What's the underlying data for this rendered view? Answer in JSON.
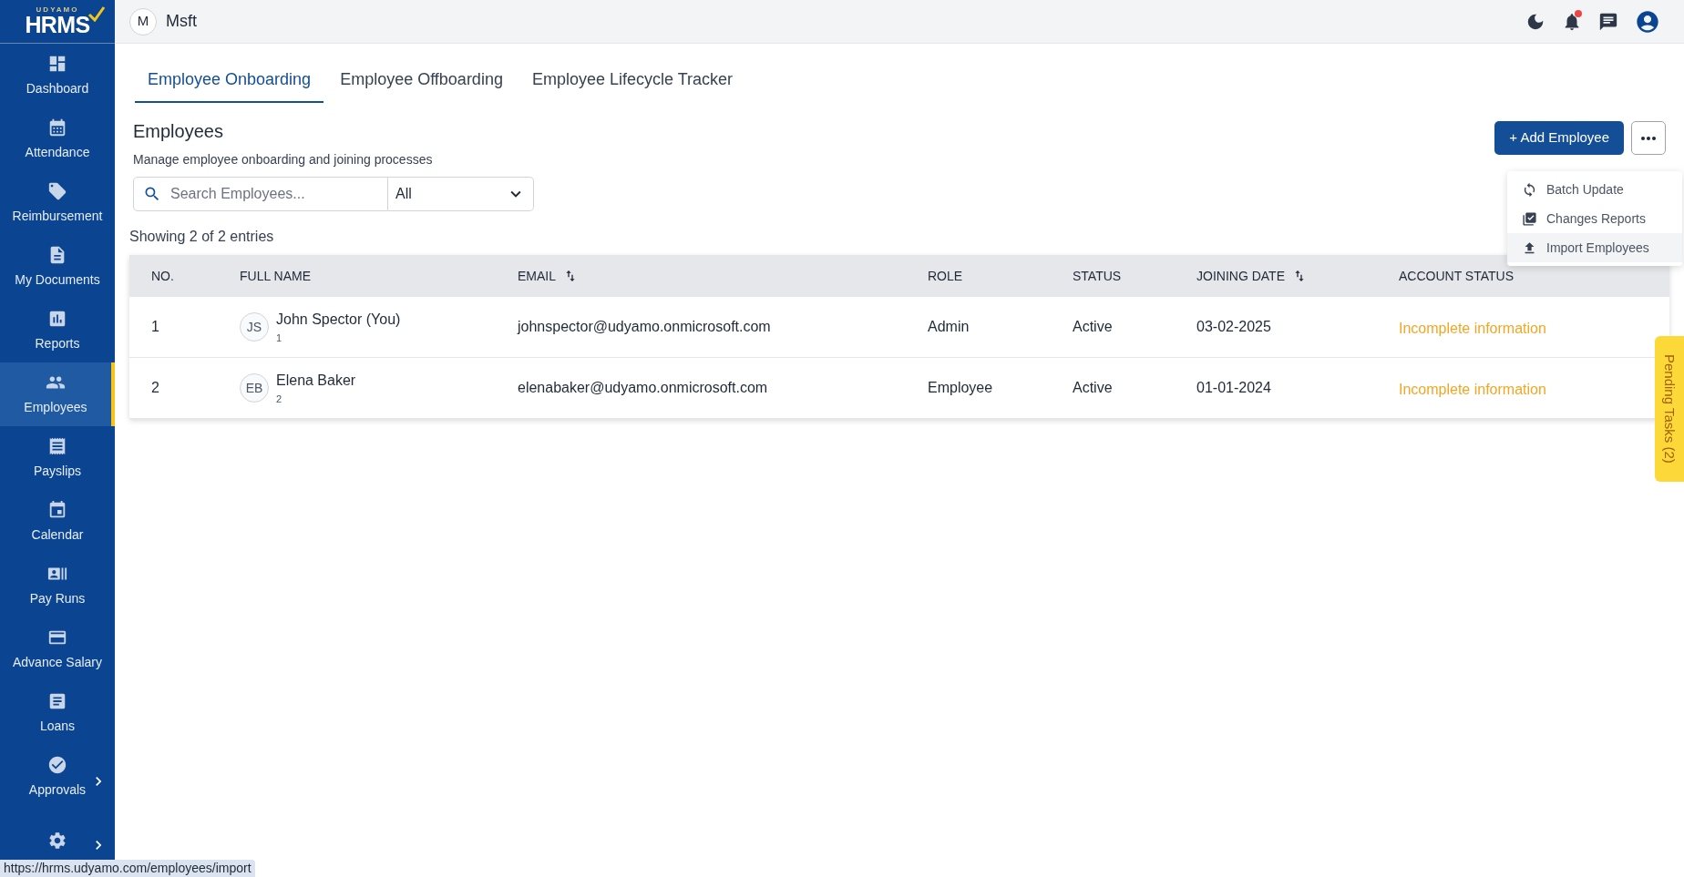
{
  "logo": {
    "small": "UDYAMO",
    "main": "HRMS"
  },
  "sidebar": {
    "items": [
      {
        "label": "Dashboard",
        "selected": false,
        "expandable": false
      },
      {
        "label": "Attendance",
        "selected": false,
        "expandable": false
      },
      {
        "label": "Reimbursement",
        "selected": false,
        "expandable": false
      },
      {
        "label": "My Documents",
        "selected": false,
        "expandable": false
      },
      {
        "label": "Reports",
        "selected": false,
        "expandable": false
      },
      {
        "label": "Employees",
        "selected": true,
        "expandable": false
      },
      {
        "label": "Payslips",
        "selected": false,
        "expandable": false
      },
      {
        "label": "Calendar",
        "selected": false,
        "expandable": false
      },
      {
        "label": "Pay Runs",
        "selected": false,
        "expandable": false
      },
      {
        "label": "Advance Salary",
        "selected": false,
        "expandable": false
      },
      {
        "label": "Loans",
        "selected": false,
        "expandable": false
      },
      {
        "label": "Approvals",
        "selected": false,
        "expandable": true
      },
      {
        "selected": false,
        "expandable": true
      }
    ]
  },
  "topbar": {
    "org_initial": "M",
    "org_name": "Msft",
    "has_notification": true
  },
  "tabs": [
    {
      "label": "Employee Onboarding",
      "selected": true
    },
    {
      "label": "Employee Offboarding",
      "selected": false
    },
    {
      "label": "Employee Lifecycle Tracker",
      "selected": false
    }
  ],
  "header": {
    "title": "Employees",
    "subtitle": "Manage employee onboarding and joining processes",
    "add_button": "+ Add Employee"
  },
  "menu": [
    {
      "label": "Batch Update",
      "selected": false
    },
    {
      "label": "Changes Reports",
      "selected": false
    },
    {
      "label": "Import Employees",
      "selected": true
    }
  ],
  "search": {
    "placeholder": "Search Employees..."
  },
  "filter": {
    "value": "All"
  },
  "entries": "Showing 2 of 2 entries",
  "table": {
    "columns": [
      {
        "label": "NO.",
        "sortable": false
      },
      {
        "label": "FULL NAME",
        "sortable": false
      },
      {
        "label": "EMAIL",
        "sortable": true
      },
      {
        "label": "ROLE",
        "sortable": false
      },
      {
        "label": "STATUS",
        "sortable": false
      },
      {
        "label": "JOINING DATE",
        "sortable": true
      },
      {
        "label": "ACCOUNT STATUS",
        "sortable": false
      }
    ],
    "rows": [
      {
        "no": "1",
        "initials": "JS",
        "name": "John Spector (You)",
        "id": "1",
        "email": "johnspector@udyamo.onmicrosoft.com",
        "role": "Admin",
        "status": "Active",
        "joining_date": "03-02-2025",
        "account_status": "Incomplete information"
      },
      {
        "no": "2",
        "initials": "EB",
        "name": "Elena Baker",
        "id": "2",
        "email": "elenabaker@udyamo.onmicrosoft.com",
        "role": "Employee",
        "status": "Active",
        "joining_date": "01-01-2024",
        "account_status": "Incomplete information"
      }
    ]
  },
  "pending_tab": "Pending Tasks (2)",
  "status_url": "https://hrms.udyamo.com/employees/import"
}
